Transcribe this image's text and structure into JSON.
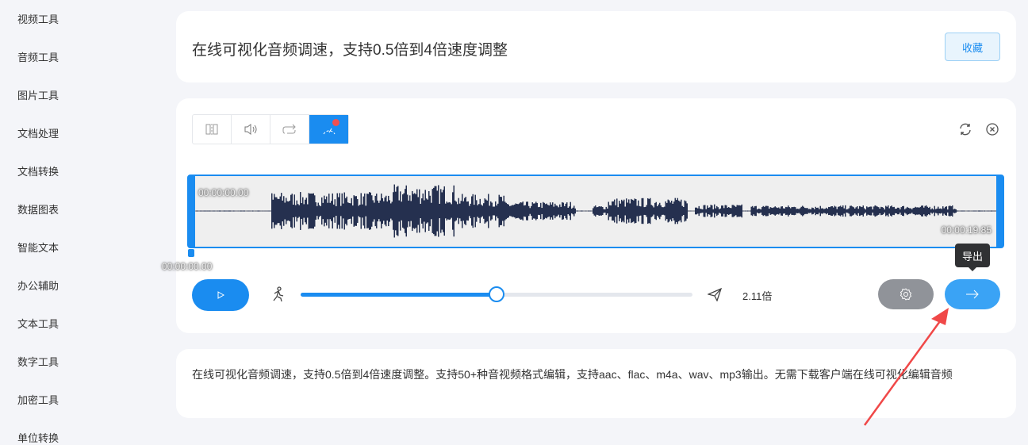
{
  "sidebar": {
    "items": [
      "视频工具",
      "音频工具",
      "图片工具",
      "文档处理",
      "文档转换",
      "数据图表",
      "智能文本",
      "办公辅助",
      "文本工具",
      "数字工具",
      "加密工具",
      "单位转换"
    ]
  },
  "header": {
    "title": "在线可视化音频调速，支持0.5倍到4倍速度调整",
    "favorite_label": "收藏"
  },
  "editor": {
    "tools": [
      "split-icon",
      "volume-icon",
      "loop-icon",
      "speed-icon"
    ],
    "start_time": "00:00:00.00",
    "end_time": "00:00:19.85",
    "cursor_time": "00:00:00.00",
    "speed_percent": 50,
    "speed_label": "2.11倍",
    "export_tooltip": "导出"
  },
  "description": "在线可视化音频调速，支持0.5倍到4倍速度调整。支持50+种音视频格式编辑，支持aac、flac、m4a、wav、mp3输出。无需下载客户端在线可视化编辑音频",
  "colors": {
    "accent": "#1a8cf0",
    "waveform": "#25304f",
    "annotation": "#f04848"
  }
}
